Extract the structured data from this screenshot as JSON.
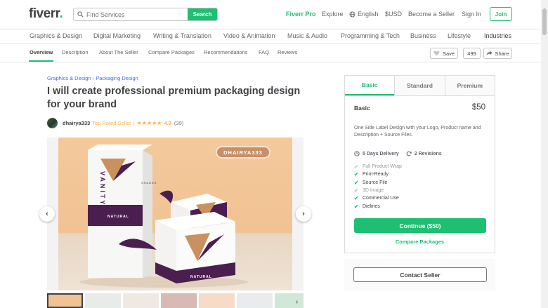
{
  "header": {
    "logo": "fiverr",
    "logo_dot": ".",
    "search_placeholder": "Find Services",
    "search_button": "Search",
    "nav": {
      "pro": "Fiverr Pro",
      "explore": "Explore",
      "language": "English",
      "currency": "$USD",
      "become_seller": "Become a Seller",
      "sign_in": "Sign In",
      "join": "Join"
    }
  },
  "categories": [
    "Graphics & Design",
    "Digital Marketing",
    "Writing & Translation",
    "Video & Animation",
    "Music & Audio",
    "Programming & Tech",
    "Business",
    "Lifestyle",
    "Industries"
  ],
  "subnav": {
    "items": [
      "Overview",
      "Description",
      "About The Seller",
      "Compare Packages",
      "Recommendations",
      "FAQ",
      "Reviews"
    ],
    "save": "Save",
    "count": "499",
    "share": "Share"
  },
  "breadcrumb": {
    "first": "Graphics & Design",
    "separator": "›",
    "second": "Packaging Design"
  },
  "gig": {
    "title": "I will create professional premium packaging design for your brand",
    "seller_name": "dhairya333",
    "seller_level": "Top Rated Seller",
    "divider": "|",
    "stars": "★★★★★",
    "rating": "4.9",
    "reviews": "(39)",
    "watermark": "DHAIRYA333",
    "rating_value": 4.9
  },
  "gallery": {
    "prev": "‹",
    "next": "›",
    "thumb_next": "›",
    "box_brand": "VANITY",
    "box_sub": "SHADES",
    "box_label": "NATURAL",
    "thumb_colors": [
      "#f2c293",
      "#e7ece9",
      "#efe9e4",
      "#d8b9b3",
      "#f6dcc6",
      "#e9ecec",
      "#cfe8d7",
      "#d9e4e0"
    ]
  },
  "package": {
    "tabs": [
      "Basic",
      "Standard",
      "Premium"
    ],
    "name": "Basic",
    "price": "$50",
    "description": "One Side Label Design with your Logo, Product name and Description + Source Files",
    "delivery": "5 Days Delivery",
    "revisions": "2 Revisions",
    "features": [
      {
        "label": "Full Product Wrap",
        "included": false
      },
      {
        "label": "Print-Ready",
        "included": true
      },
      {
        "label": "Source File",
        "included": true
      },
      {
        "label": "3D Image",
        "included": false
      },
      {
        "label": "Commercial Use",
        "included": true
      },
      {
        "label": "Dielines",
        "included": true
      }
    ],
    "continue": "Continue ($50)",
    "compare": "Compare Packages"
  },
  "contact": {
    "button": "Contact Seller"
  },
  "colors": {
    "brand_green": "#1dbf73",
    "star_gold": "#ffb33e",
    "link_blue": "#446ee7",
    "text_dark": "#404145"
  }
}
